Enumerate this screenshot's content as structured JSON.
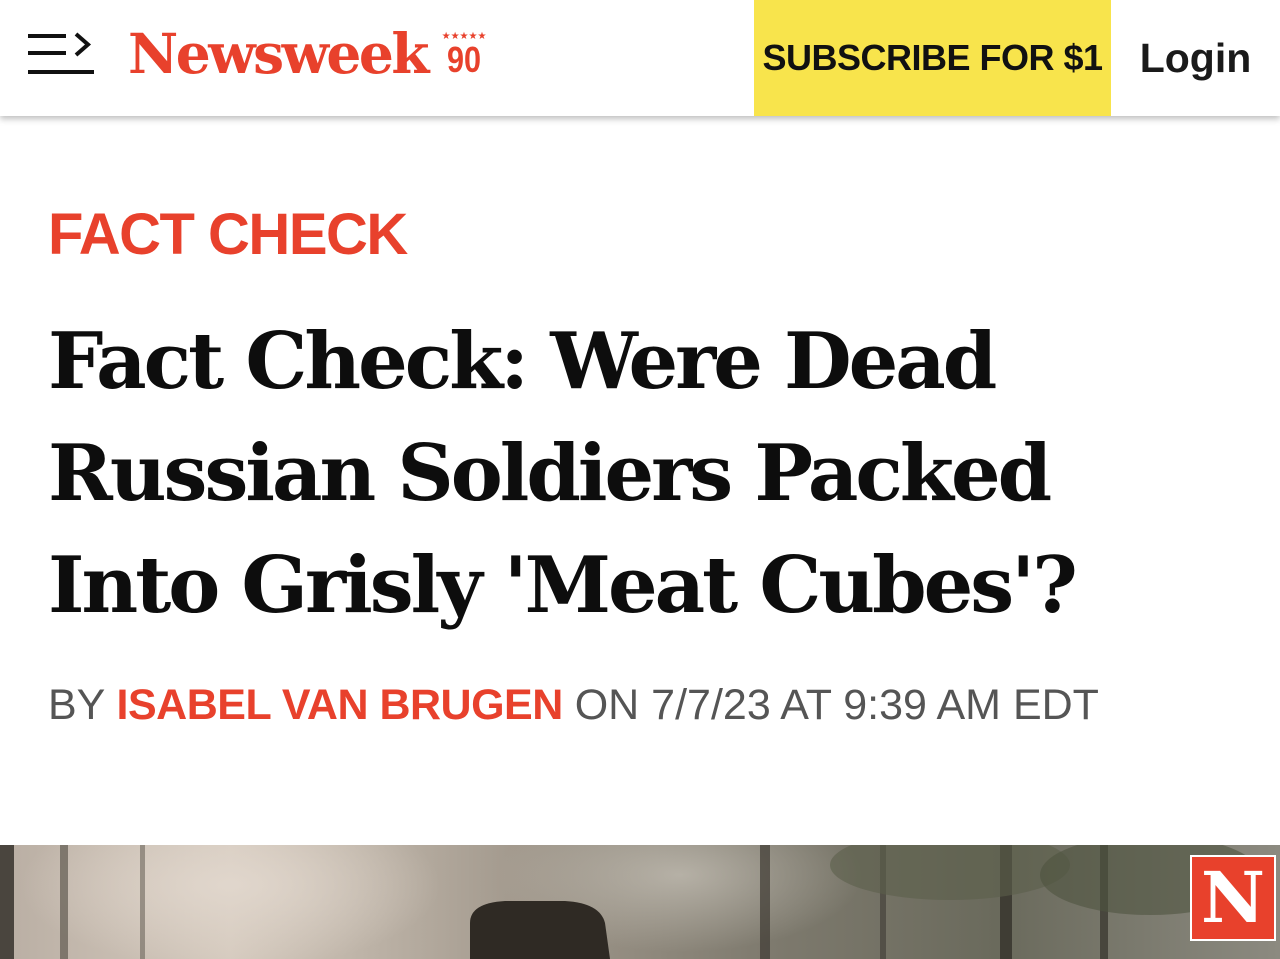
{
  "header": {
    "menu_icon": "menu-expand-icon",
    "logo_text": "Newsweek",
    "logo_badge": "90",
    "logo_stars": "★★★★★",
    "subscribe_label": "SUBSCRIBE FOR $1",
    "login_label": "Login"
  },
  "article": {
    "category": "FACT CHECK",
    "headline_lines": [
      "Fact Check: Were Dead",
      "Russian Soldiers Packed",
      "Into Grisly 'Meat Cubes'?"
    ],
    "byline_prefix": "BY",
    "author": "ISABEL VAN BRUGEN",
    "date_text": "ON 7/7/23 AT 9:39 AM EDT"
  },
  "hero": {
    "badge_letter": "N"
  },
  "colors": {
    "brand_red": "#e8412c",
    "subscribe_yellow": "#f8e44c",
    "headline_text": "#0d0d0d",
    "byline_gray": "#555555"
  }
}
